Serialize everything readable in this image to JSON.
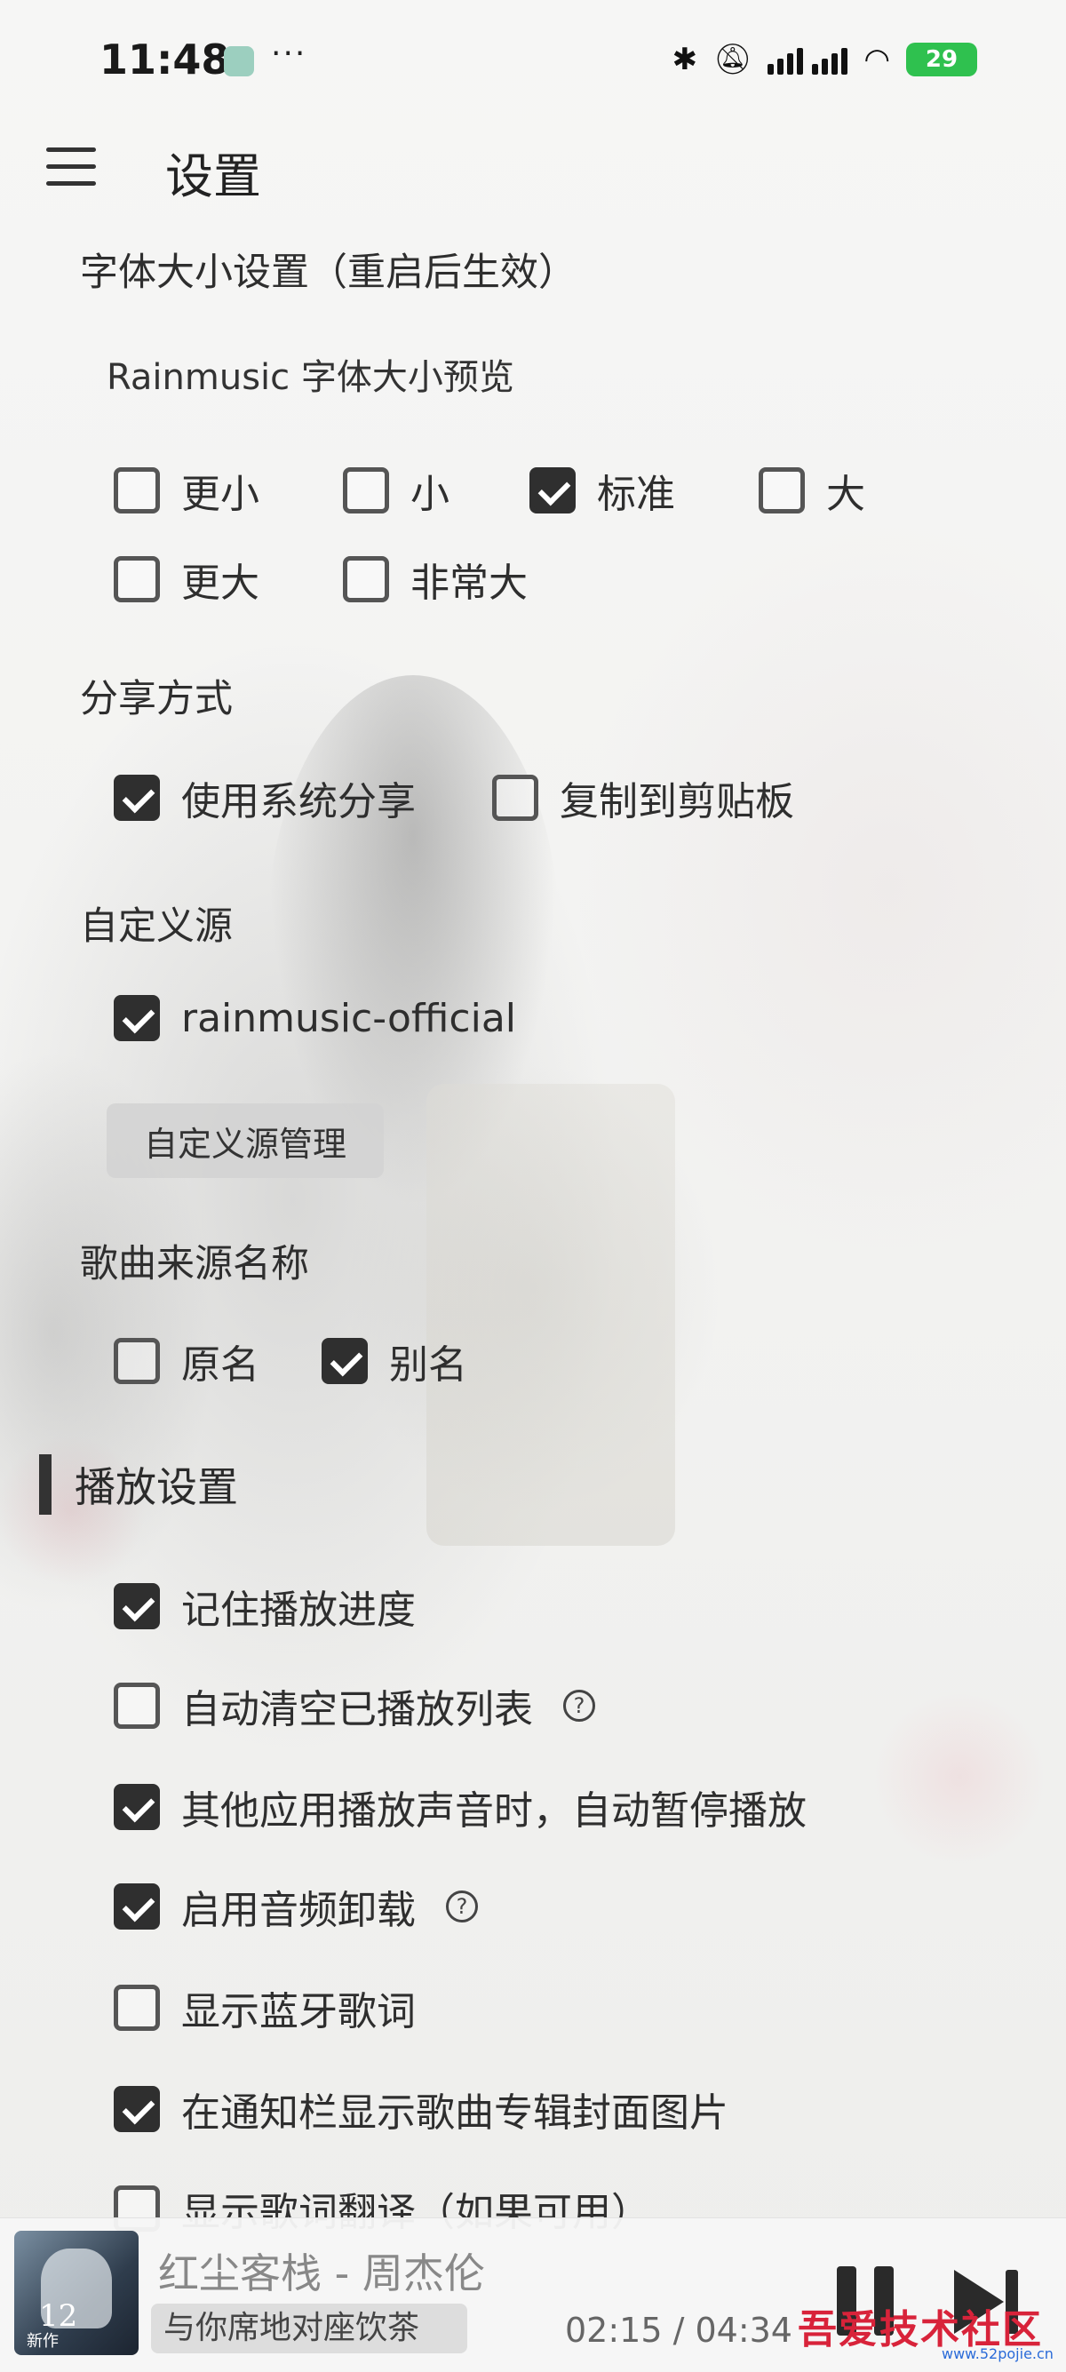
{
  "status_bar": {
    "time": "11:48",
    "more": "···",
    "battery": "29"
  },
  "header": {
    "title": "设置"
  },
  "font_size": {
    "section_title": "字体大小设置（重启后生效）",
    "preview": "Rainmusic 字体大小预览",
    "options": [
      {
        "label": "更小",
        "checked": false
      },
      {
        "label": "小",
        "checked": false
      },
      {
        "label": "标准",
        "checked": true
      },
      {
        "label": "大",
        "checked": false
      },
      {
        "label": "更大",
        "checked": false
      },
      {
        "label": "非常大",
        "checked": false
      }
    ]
  },
  "share": {
    "section_title": "分享方式",
    "options": [
      {
        "label": "使用系统分享",
        "checked": true
      },
      {
        "label": "复制到剪贴板",
        "checked": false
      }
    ]
  },
  "custom_source": {
    "section_title": "自定义源",
    "options": [
      {
        "label": "rainmusic-official",
        "checked": true
      }
    ],
    "manage_button": "自定义源管理"
  },
  "song_source_name": {
    "section_title": "歌曲来源名称",
    "options": [
      {
        "label": "原名",
        "checked": false
      },
      {
        "label": "别名",
        "checked": true
      }
    ]
  },
  "playback": {
    "section_title": "播放设置",
    "options": [
      {
        "label": "记住播放进度",
        "checked": true
      },
      {
        "label": "自动清空已播放列表",
        "checked": false,
        "help": "?"
      },
      {
        "label": "其他应用播放声音时，自动暂停播放",
        "checked": true
      },
      {
        "label": "启用音频卸载",
        "checked": true,
        "help": "?"
      },
      {
        "label": "显示蓝牙歌词",
        "checked": false
      },
      {
        "label": "在通知栏显示歌曲专辑封面图片",
        "checked": true
      },
      {
        "label": "显示歌词翻译（如果可用）",
        "checked": false
      }
    ]
  },
  "player": {
    "song": "红尘客栈 - 周杰伦",
    "lyric": "与你席地对座饮茶",
    "time": "02:15 / 04:34",
    "cover_text": {
      "number": "12",
      "caption": "新作"
    }
  },
  "watermark": {
    "text": "吾爱技术社区",
    "sub": "www.52pojie.cn"
  }
}
